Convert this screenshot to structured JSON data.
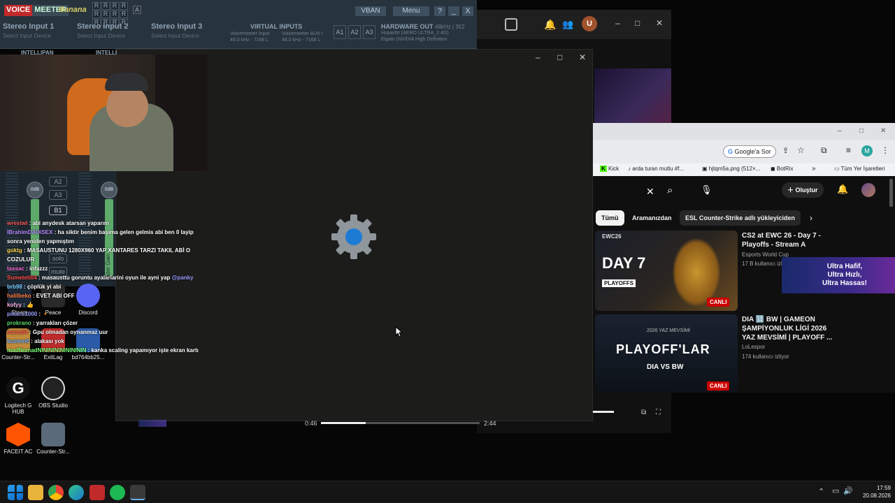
{
  "voicemeeter": {
    "brand_voice": "VOICE",
    "brand_meeter": "MEETER",
    "brand_banana": "Banana",
    "r_buttons": [
      "R",
      "R",
      "R",
      "R",
      "R",
      "R",
      "R",
      "R",
      "R",
      "R",
      "R",
      "R"
    ],
    "a_label": "A",
    "vban": "VBAN",
    "menu": "Menu",
    "help": "?",
    "minimize": "_",
    "close": "X",
    "inputs": [
      {
        "name": "Stereo Input 1",
        "device": "Select Input Device"
      },
      {
        "name": "Stereo Input 2",
        "device": "Select Input Device"
      },
      {
        "name": "Stereo Input 3",
        "device": "Select Input Device"
      }
    ],
    "virtual_title": "VIRTUAL INPUTS",
    "virtual": [
      {
        "name": "Voicemeeter Input",
        "rate": "48.0 kHz - 7168 L"
      },
      {
        "name": "Voicemeeter AUX I",
        "rate": "48.0 kHz - 7168 L"
      }
    ],
    "a_buttons": [
      "A1",
      "A2",
      "A3"
    ],
    "hw_title": "HARDWARE OUT",
    "hw_rate": "48kHz | 352",
    "hw_lines": [
      "Hoparlör (AERO ULTRA_2.4G)",
      "Elgato (NVIDIA High Definition"
    ],
    "intellipan": "INTELLIPAN",
    "intelli_short": "INTELLI",
    "knob_left": "0dB",
    "knob_right": "0dB",
    "bus_buttons": [
      "A2",
      "A3",
      "B1"
    ],
    "fader_label": "Fader Gain",
    "solo": "solo",
    "mute": "mute"
  },
  "chat": [
    {
      "user": "wrestwl",
      "user_color": "#ff5a5a",
      "msg": "abi anydesk atarsan yaparım"
    },
    {
      "user": "IBrahimDADiSEX",
      "user_color": "#b58cff",
      "msg": "ha siktir benim başıma gelen gelmis abi ben 0 layip sonra yeniden yapmıştım"
    },
    {
      "user": "goktg",
      "user_color": "#ffd24a",
      "msg": "MASAUSTUNU 1280X960 YAP XANTARES TARZI TAKIL ABİ O COZULUR"
    },
    {
      "user": "tassac",
      "user_color": "#ff6ad5",
      "msg": "infazzz"
    },
    {
      "user": "Sumeteti04",
      "user_color": "#ff4a4a",
      "msg": "masausttu goruntu ayalarlarini oyun ile ayni yap",
      "mention": "@panky"
    },
    {
      "user": "brb98",
      "user_color": "#7ad0ff",
      "msg": "çöplük yi abi"
    },
    {
      "user": "halilbeko",
      "user_color": "#ff7a3a",
      "msg": "EVET ABI OFF"
    },
    {
      "user": "kofyy",
      "user_color": "#ffb0e0",
      "msg": "👍"
    },
    {
      "user": "pikacu1000",
      "user_color": "#9aa0ff",
      "msg": "🔸"
    },
    {
      "user": "prokrano",
      "user_color": "#59d96a",
      "msg": "yarrakları çözer"
    },
    {
      "user": "szzza34",
      "user_color": "#ff5555",
      "msg": "Gpu olmadan oynanmaz uur"
    },
    {
      "user": "kuzenn0",
      "user_color": "#6ab0ff",
      "msg": "alakası yok"
    },
    {
      "user": "madNomadNININININININININ",
      "user_color": "#7aff7a",
      "msg": "kanka scaling yapamıyor işte ekran kartı"
    }
  ],
  "desktop_icons": [
    {
      "label": "Steam",
      "icon": "steam-icon"
    },
    {
      "label": "Peace",
      "icon": "peace-icon"
    },
    {
      "label": "Discord",
      "icon": "discord-icon"
    },
    {
      "label": "Counter-Str...",
      "icon": "cs-icon"
    },
    {
      "label": "ExitLag",
      "icon": "exitlag-icon"
    },
    {
      "label": "bd764bb25...",
      "icon": "image-file-icon"
    },
    {
      "label": "Logitech G HUB",
      "icon": "logitech-icon"
    },
    {
      "label": "OBS Studio",
      "icon": "obs-icon"
    },
    {
      "label": "FACEIT AC",
      "icon": "faceit-icon"
    },
    {
      "label": "Counter-Str...",
      "icon": "cs-icon"
    }
  ],
  "gear_window": {
    "minimize": "–",
    "maximize": "□",
    "close": "✕"
  },
  "video": {
    "current": "0:46",
    "total": "2:44",
    "progress": 0.28
  },
  "browser": {
    "avatar_letter": "U",
    "google_btn": "Google'a Sor",
    "profile_letter": "M",
    "bookmarks": [
      "Kick",
      "arda turan mutlu #f...",
      "hjtqm5a.png (512×...",
      "BotRix"
    ],
    "more": "»",
    "all_bookmarks": "Tüm Yer İşaretleri",
    "create": "Oluştur",
    "chips": [
      "Tümü",
      "Aramanızdan",
      "ESL Counter-Strike adlı yükleyiciden"
    ],
    "videos": [
      {
        "title": "CS2 at EWC 26 - Day 7 - Playoffs - Stream A",
        "channel": "Esports World Cup",
        "meta": "17 B kullanıcı izliyor",
        "live": "CANLI",
        "thumb_big": "DAY 7",
        "thumb_small": "PLAYOFFS",
        "thumb_tag": "EWC26"
      },
      {
        "title": "DIA 🔢 BW | GAMEON ŞAMPİYONLUK LİGİ 2026 YAZ MEVSİMİ | PLAYOFF ...",
        "channel": "LoLespor",
        "meta": "174 kullanıcı izliyor",
        "live": "CANLI",
        "thumb_big": "PLAYOFF'LAR",
        "thumb_small": "2026 YAZ MEVSİMİ",
        "thumb_vs": "DIA VS BW"
      }
    ],
    "ad_lines": [
      "Ultra Hafif,",
      "Ultra Hızlı,",
      "Ultra Hassas!"
    ]
  },
  "taskbar": {
    "time": "17:59",
    "date": "20.08.2026",
    "apps": [
      "start-icon",
      "file-explorer-icon",
      "chrome-icon",
      "edge-icon",
      "voicemeeter-icon",
      "spotify-icon",
      "settings-icon"
    ]
  },
  "colors": {
    "accent_blue": "#1e7bd4",
    "live_red": "#cc0000",
    "vm_bg": "#27333d"
  }
}
